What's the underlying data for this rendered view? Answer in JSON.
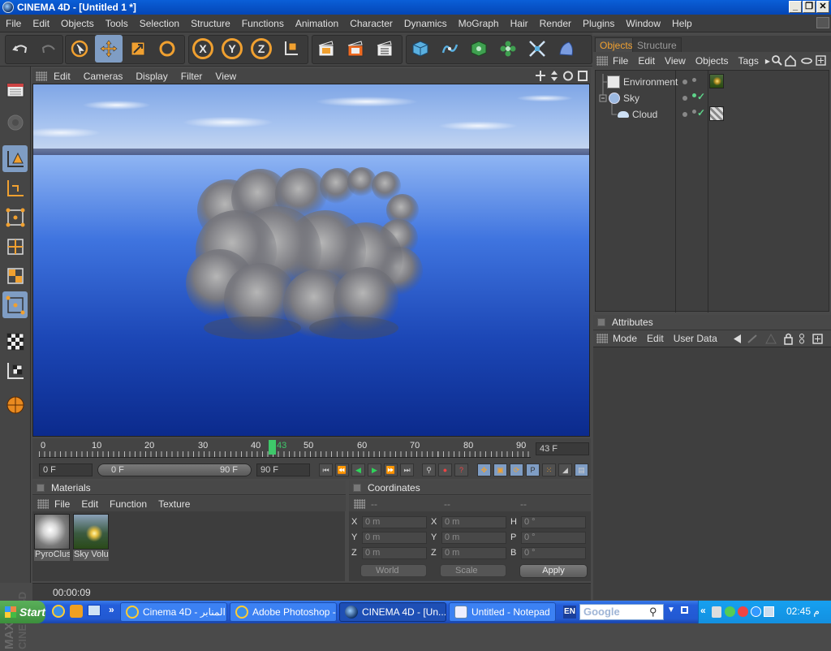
{
  "window": {
    "title": "CINEMA 4D - [Untitled 1 *]"
  },
  "menubar": [
    "File",
    "Edit",
    "Objects",
    "Tools",
    "Selection",
    "Structure",
    "Functions",
    "Animation",
    "Character",
    "Dynamics",
    "MoGraph",
    "Hair",
    "Render",
    "Plugins",
    "Window",
    "Help"
  ],
  "toolbar": {
    "axis_x": "X",
    "axis_y": "Y",
    "axis_z": "Z"
  },
  "viewport": {
    "menu": [
      "Edit",
      "Cameras",
      "Display",
      "Filter",
      "View"
    ]
  },
  "timeline": {
    "ticks": [
      "0",
      "10",
      "20",
      "30",
      "40",
      "50",
      "60",
      "70",
      "80",
      "90"
    ],
    "current_frame_label": "43",
    "current_frame_field": "43 F"
  },
  "transport": {
    "start_field": "0 F",
    "range_start": "0 F",
    "range_end": "90 F",
    "end_field": "90 F"
  },
  "materials": {
    "title": "Materials",
    "menu": [
      "File",
      "Edit",
      "Function",
      "Texture"
    ],
    "items": [
      {
        "label": "PyroClus"
      },
      {
        "label": "Sky Volu"
      }
    ]
  },
  "coordinates": {
    "title": "Coordinates",
    "col_headers": [
      "--",
      "--",
      "--"
    ],
    "rows": [
      {
        "l1": "X",
        "v1": "0 m",
        "l2": "X",
        "v2": "0 m",
        "l3": "H",
        "v3": "0 °"
      },
      {
        "l1": "Y",
        "v1": "0 m",
        "l2": "Y",
        "v2": "0 m",
        "l3": "P",
        "v3": "0 °"
      },
      {
        "l1": "Z",
        "v1": "0 m",
        "l2": "Z",
        "v2": "0 m",
        "l3": "B",
        "v3": "0 °"
      }
    ],
    "mode_select": "World",
    "scale_select": "Scale",
    "apply_label": "Apply"
  },
  "statusbar": {
    "time": "00:00:09"
  },
  "objects_panel": {
    "tabs": [
      "Objects",
      "Structure"
    ],
    "menu": [
      "File",
      "Edit",
      "View",
      "Objects",
      "Tags"
    ],
    "items": [
      {
        "name": "Environment"
      },
      {
        "name": "Sky"
      },
      {
        "name": "Cloud"
      }
    ]
  },
  "attributes_panel": {
    "title": "Attributes",
    "menu": [
      "Mode",
      "Edit",
      "User Data"
    ]
  },
  "taskbar": {
    "start_label": "Start",
    "tasks": [
      {
        "label": "Cinema 4D - المنابر ..."
      },
      {
        "label": "Adobe Photoshop -..."
      },
      {
        "label": "CINEMA 4D - [Un..."
      },
      {
        "label": "Untitled - Notepad"
      }
    ],
    "language": "EN",
    "search_placeholder": "Google",
    "clock": "02:45 م"
  },
  "colors": {
    "accent_orange": "#f0a030",
    "active_blue": "#7f9dc4",
    "playhead_green": "#3ec86a",
    "panel_bg": "#3f3f3f"
  }
}
